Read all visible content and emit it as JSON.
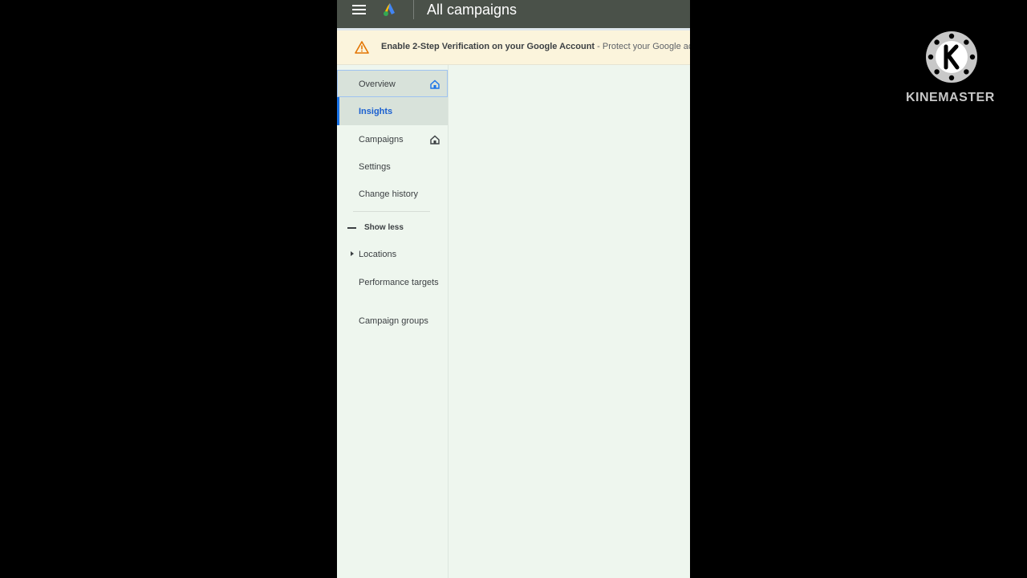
{
  "header": {
    "title": "All campaigns",
    "menu_icon": "hamburger-menu-icon",
    "logo_icon": "google-ads-logo-icon",
    "bar_color": "#4a5149"
  },
  "banner": {
    "icon": "warning-triangle-icon",
    "bold_text": "Enable 2-Step Verification on your Google Account",
    "rest_text": " - Protect your Google acco",
    "background": "#fbf4dc"
  },
  "sidebar": {
    "items": [
      {
        "label": "Overview",
        "state": "focused",
        "icon": "home-icon"
      },
      {
        "label": "Insights",
        "state": "selected"
      },
      {
        "label": "Campaigns",
        "icon": "home-icon"
      },
      {
        "label": "Settings"
      },
      {
        "label": "Change history"
      }
    ],
    "toggle_label": "Show less",
    "extra_items": [
      {
        "label": "Locations",
        "icon": "caret-right-icon"
      },
      {
        "label": "Performance targets"
      },
      {
        "label": "Campaign groups"
      }
    ],
    "accent_color": "#1a73e8"
  },
  "watermark": {
    "text": "KINEMASTER",
    "icon": "kinemaster-logo-icon"
  }
}
